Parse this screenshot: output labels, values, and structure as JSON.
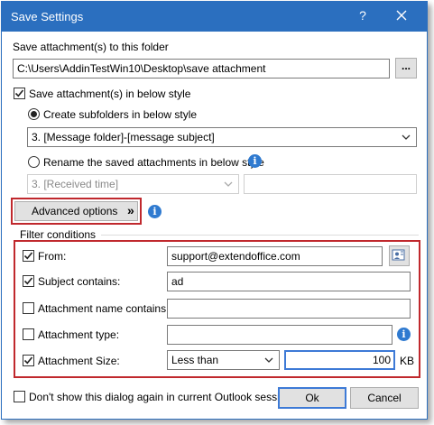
{
  "window": {
    "title": "Save Settings",
    "help_glyph": "?",
    "close_glyph": "×"
  },
  "folder": {
    "label": "Save attachment(s) to this folder",
    "path": "C:\\Users\\AddinTestWin10\\Desktop\\save attachment",
    "browse_label": "..."
  },
  "style": {
    "checkbox_label": "Save attachment(s) in below style",
    "checked": true,
    "create_subfolders_label": "Create subfolders in below style",
    "subfolder_selected": "3. [Message folder]-[message subject]",
    "rename_label": "Rename the saved attachments in below style",
    "rename_selected": "3. [Received time]",
    "rename_text": ""
  },
  "advanced": {
    "button_label": "Advanced options",
    "chevron": "»"
  },
  "filter": {
    "group_title": "Filter conditions",
    "from_label": "From:",
    "from_checked": true,
    "from_value": "support@extendoffice.com",
    "subject_label": "Subject contains:",
    "subject_checked": true,
    "subject_value": "ad",
    "att_name_label": "Attachment name contains:",
    "att_name_checked": false,
    "att_name_value": "",
    "att_type_label": "Attachment type:",
    "att_type_checked": false,
    "att_type_value": "",
    "att_size_label": "Attachment Size:",
    "att_size_checked": true,
    "size_operator": "Less than",
    "size_value": "100",
    "size_unit": "KB"
  },
  "footer": {
    "dont_show_label": "Don't show this dialog again in current Outlook session.",
    "dont_show_checked": false,
    "ok_label": "Ok",
    "cancel_label": "Cancel"
  },
  "colors": {
    "accent": "#2b6fbf",
    "highlight_box": "#c0282d",
    "info_icon": "#2f7ad0"
  },
  "icons": [
    "close-icon",
    "help-icon",
    "browse-ellipsis",
    "chevron-down-icon",
    "info-icon",
    "address-book-icon",
    "check-icon"
  ]
}
